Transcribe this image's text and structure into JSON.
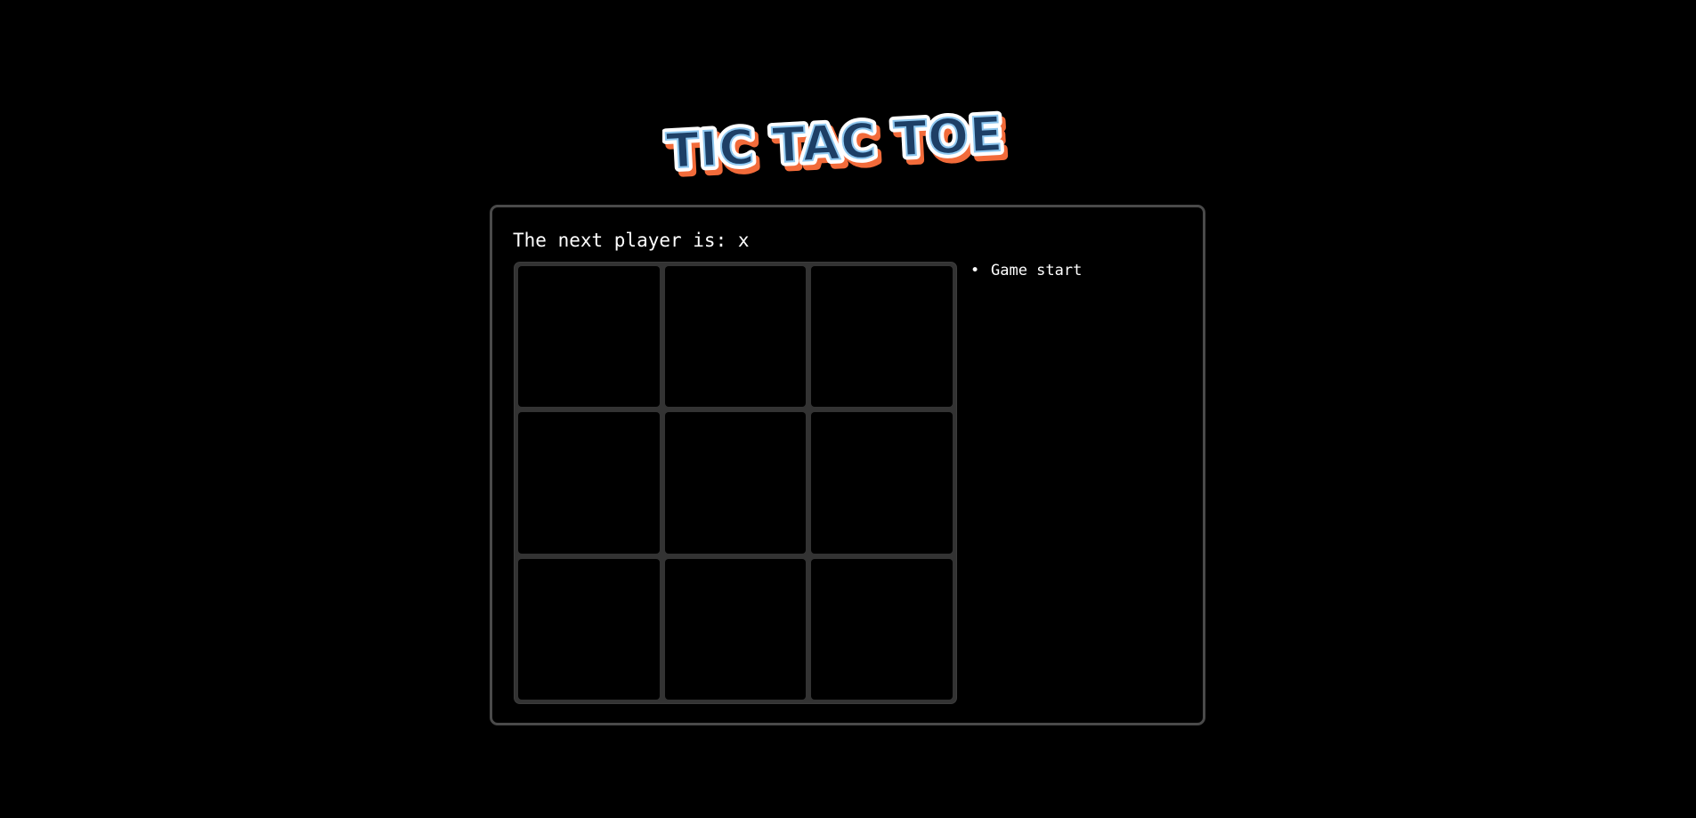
{
  "logo": {
    "text": "TIC TAC TOE"
  },
  "game": {
    "status": "The next player is: x",
    "squares": [
      "",
      "",
      "",
      "",
      "",
      "",
      "",
      "",
      ""
    ]
  },
  "history": {
    "moves": [
      {
        "label": "Game start"
      }
    ]
  },
  "colors": {
    "background": "#000000",
    "panel_border": "#4a4a4a",
    "grid": "#333333",
    "logo_fill": "#1d3f66",
    "logo_outline": "#ffffff",
    "logo_shadow": "#f26b3a",
    "text": "#ffffff"
  }
}
